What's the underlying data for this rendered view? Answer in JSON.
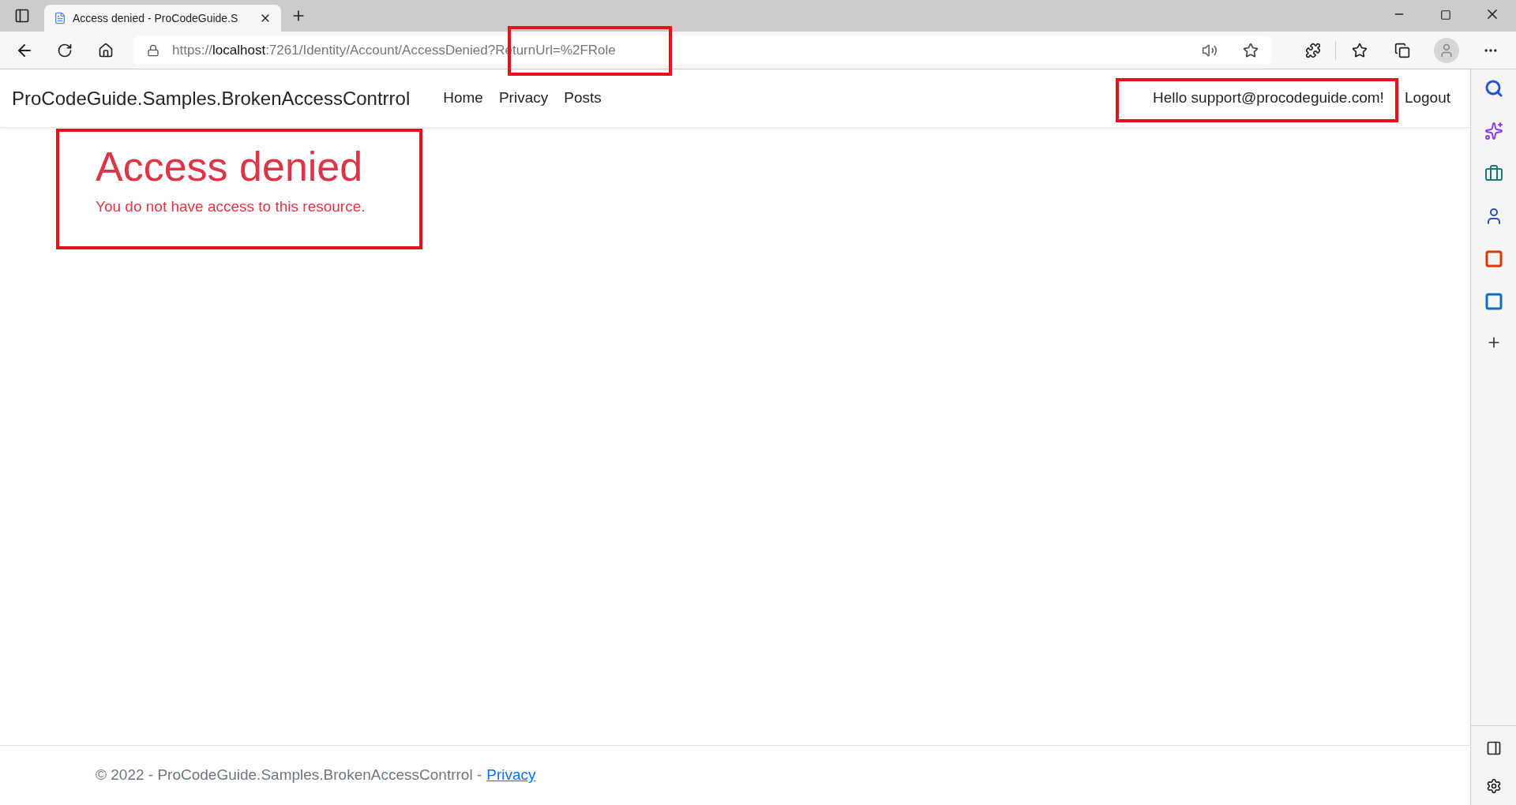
{
  "browser": {
    "tab": {
      "title": "Access denied - ProCodeGuide.S",
      "selected": true
    },
    "url": {
      "scheme": "https://",
      "host": "localhost",
      "path": ":7261/Identity/Account/AccessDenied?ReturnUrl=%2FRole"
    }
  },
  "navbar": {
    "brand": "ProCodeGuide.Samples.BrokenAccessContrrol",
    "links": [
      "Home",
      "Privacy",
      "Posts"
    ],
    "greeting": "Hello support@procodeguide.com!",
    "logout": "Logout"
  },
  "content": {
    "heading": "Access denied",
    "message": "You do not have access to this resource."
  },
  "footer": {
    "text": "© 2022 - ProCodeGuide.Samples.BrokenAccessContrrol -",
    "link": "Privacy"
  }
}
